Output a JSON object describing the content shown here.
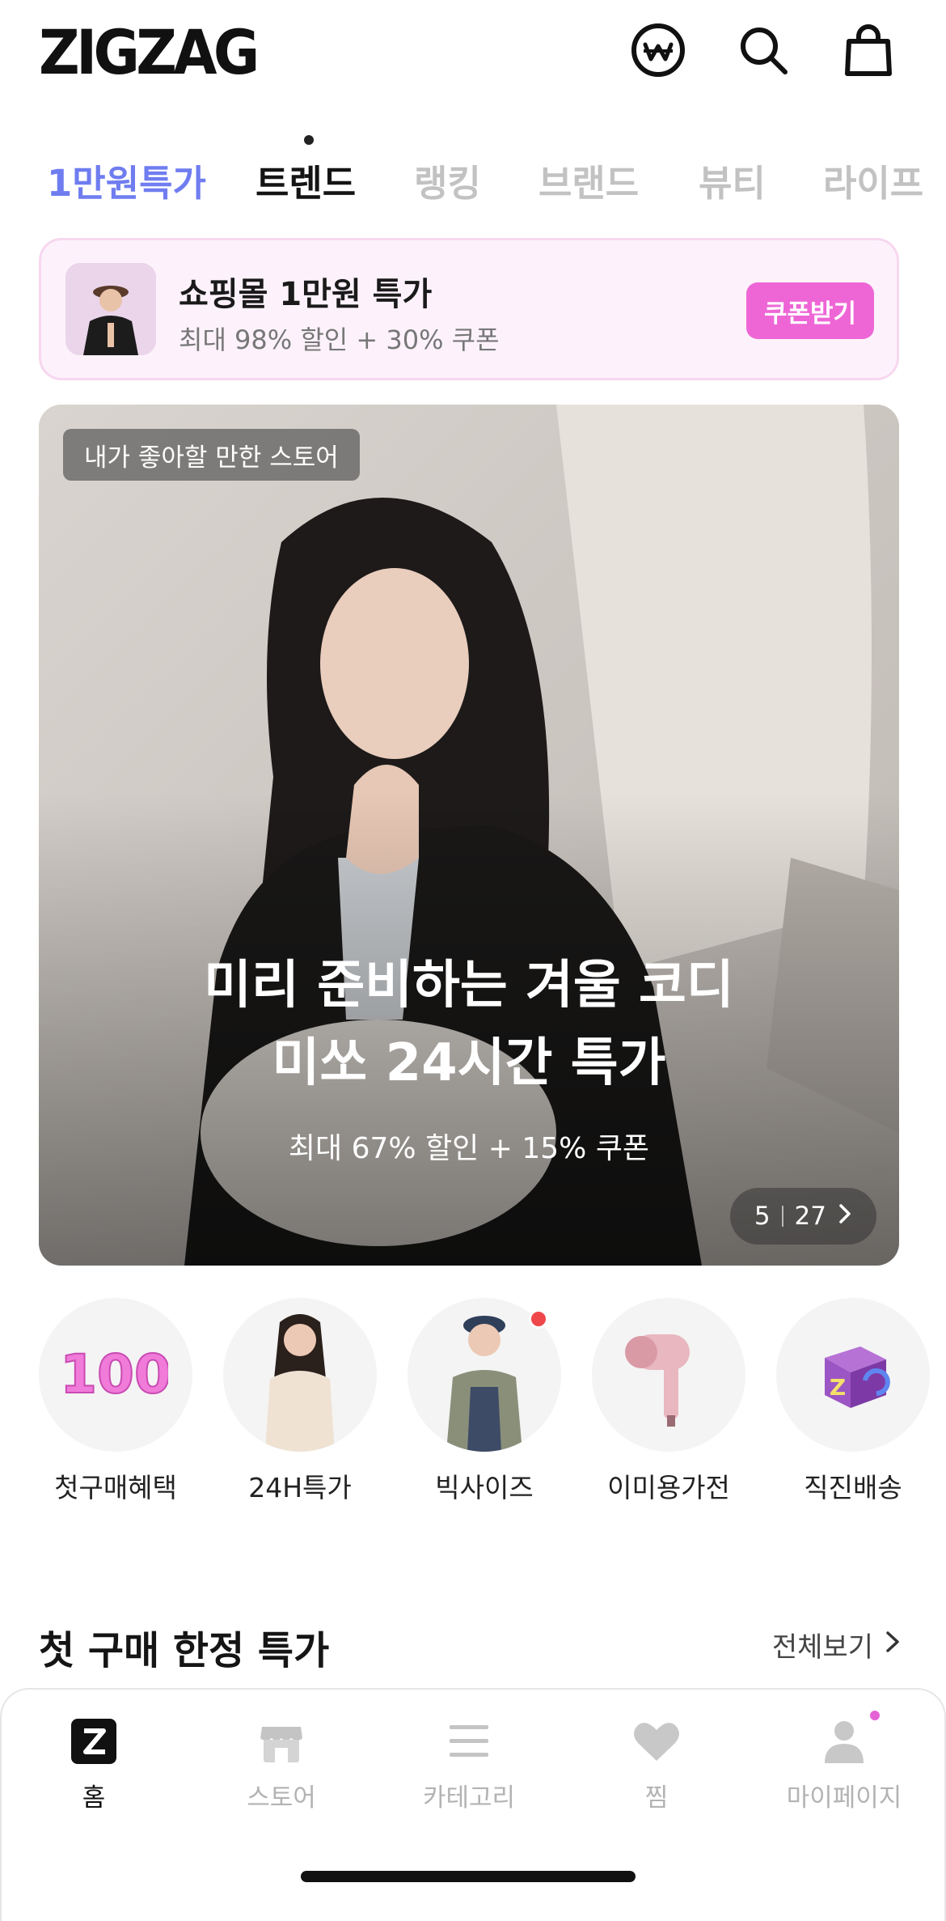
{
  "header": {
    "logo": "ZIGZAG",
    "icons": [
      "won-coin-icon",
      "search-icon",
      "shopping-bag-icon"
    ]
  },
  "tabs": [
    {
      "label": "1만원특가",
      "state": "highlighted"
    },
    {
      "label": "트렌드",
      "state": "selected"
    },
    {
      "label": "랭킹",
      "state": "default"
    },
    {
      "label": "브랜드",
      "state": "default"
    },
    {
      "label": "뷰티",
      "state": "default"
    },
    {
      "label": "라이프",
      "state": "default"
    }
  ],
  "coupon_banner": {
    "title": "쇼핑몰 1만원 특가",
    "subtitle": "최대 98% 할인 + 30% 쿠폰",
    "button_label": "쿠폰받기",
    "accent_color": "#ee66d6"
  },
  "hero": {
    "tag": "내가 좋아할 만한 스토어",
    "title_line1": "미리 준비하는 겨울 코디",
    "title_line2": "미쏘 24시간 특가",
    "subtitle": "최대 67% 할인 + 15% 쿠폰",
    "pager_current": "5",
    "pager_total": "27"
  },
  "categories": [
    {
      "label": "첫구매혜택",
      "icon": "100-badge-icon",
      "has_new_dot": false
    },
    {
      "label": "24H특가",
      "icon": "model-photo",
      "has_new_dot": false
    },
    {
      "label": "빅사이즈",
      "icon": "model-photo",
      "has_new_dot": true
    },
    {
      "label": "이미용가전",
      "icon": "hair-dryer-icon",
      "has_new_dot": false
    },
    {
      "label": "직진배송",
      "icon": "z-box-icon",
      "has_new_dot": false
    }
  ],
  "section": {
    "title": "첫 구매 한정 특가",
    "more_label": "전체보기"
  },
  "bottom_nav": [
    {
      "label": "홈",
      "icon": "z-home-icon",
      "active": true
    },
    {
      "label": "스토어",
      "icon": "store-icon",
      "active": false
    },
    {
      "label": "카테고리",
      "icon": "menu-lines-icon",
      "active": false
    },
    {
      "label": "찜",
      "icon": "heart-icon",
      "active": false
    },
    {
      "label": "마이페이지",
      "icon": "person-icon",
      "active": false,
      "has_new_dot": true
    }
  ],
  "colors": {
    "tab_highlight": "#6f7df0",
    "coupon_bg": "#fdf2fb",
    "new_dot": "#f0474a",
    "mypage_dot": "#e562d6"
  }
}
